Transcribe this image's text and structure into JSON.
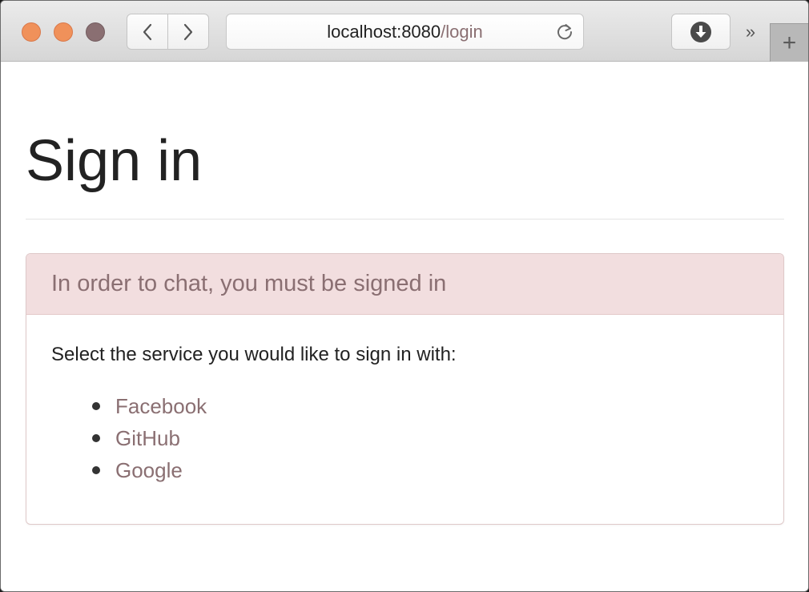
{
  "browser": {
    "url_host": "localhost:8080",
    "url_path": "/login",
    "overflow_label": "»",
    "new_tab_label": "+",
    "icons": {
      "back": "chevron-left-icon",
      "forward": "chevron-right-icon",
      "reload": "reload-icon",
      "download": "download-icon"
    },
    "colors": {
      "traffic_close": "#f0915a",
      "traffic_minimize": "#f0915a",
      "traffic_maximize": "#8a6f72"
    }
  },
  "page": {
    "title": "Sign in",
    "panel": {
      "heading": "In order to chat, you must be signed in",
      "body_text": "Select the service you would like to sign in with:",
      "services": [
        {
          "label": "Facebook"
        },
        {
          "label": "GitHub"
        },
        {
          "label": "Google"
        }
      ]
    },
    "colors": {
      "panel_heading_bg": "#f2dedf",
      "link": "#8a6f72"
    }
  }
}
